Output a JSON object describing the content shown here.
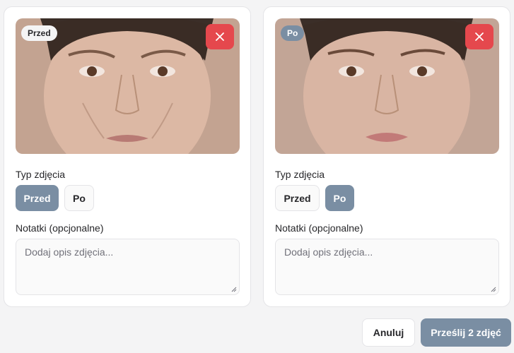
{
  "photos": [
    {
      "tag": "Przed",
      "type_label": "Typ zdjęcia",
      "options": [
        "Przed",
        "Po"
      ],
      "selected": "Przed",
      "notes_label": "Notatki (opcjonalne)",
      "notes_placeholder": "Dodaj opis zdjęcia..."
    },
    {
      "tag": "Po",
      "type_label": "Typ zdjęcia",
      "options": [
        "Przed",
        "Po"
      ],
      "selected": "Po",
      "notes_label": "Notatki (opcjonalne)",
      "notes_placeholder": "Dodaj opis zdjęcia..."
    }
  ],
  "actions": {
    "cancel": "Anuluj",
    "submit": "Prześlij 2 zdjęć"
  },
  "colors": {
    "accent": "#7a8ea3",
    "danger": "#e5484d"
  },
  "icons": {
    "remove": "close-icon"
  }
}
